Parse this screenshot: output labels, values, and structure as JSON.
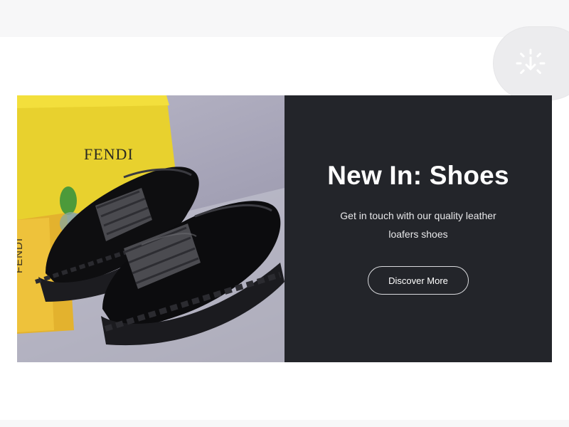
{
  "banner": {
    "title": "New In: Shoes",
    "subtitle": "Get in touch with our quality leather loafers shoes",
    "cta_label": "Discover More",
    "image_label": "product image: black loafers with box and dust bag",
    "brand_box_text": "FENDI",
    "brand_bag_text": "FENDI"
  },
  "floating_action": {
    "icon": "download-loader-icon"
  },
  "colors": {
    "page_bg": "#f7f7f8",
    "banner_panel": "#23252a",
    "cta_border": "#d9dadd"
  }
}
